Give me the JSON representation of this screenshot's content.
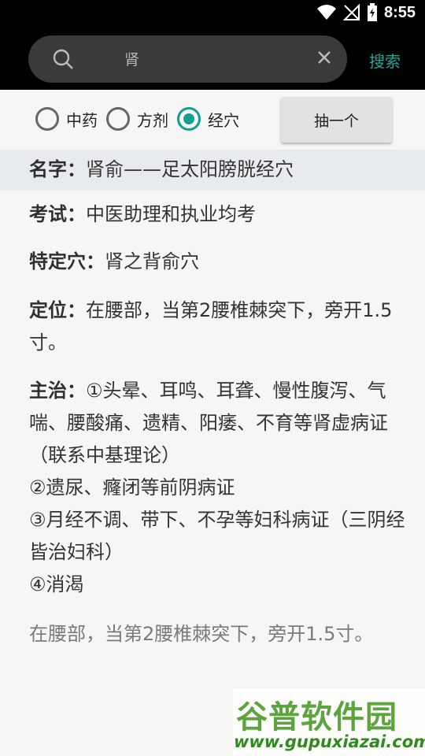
{
  "status_bar": {
    "time": "8:55"
  },
  "search": {
    "query": "肾",
    "button_label": "搜索"
  },
  "types": [
    {
      "label": "中药",
      "checked": false
    },
    {
      "label": "方剂",
      "checked": false
    },
    {
      "label": "经穴",
      "checked": true
    }
  ],
  "draw_button": "抽一个",
  "detail": {
    "name_label": "名字：",
    "name_value": "肾俞——足太阳膀胱经穴",
    "exam_label": "考试：",
    "exam_value": "中医助理和执业均考",
    "special_label": "特定穴：",
    "special_value": "肾之背俞穴",
    "location_label": "定位：",
    "location_value": "在腰部，当第2腰椎棘突下，旁开1.5寸。",
    "indication_label": "主治：",
    "indication_lines": [
      "①头晕、耳鸣、耳聋、慢性腹泻、气喘、腰酸痛、遗精、阳痿、不育等肾虚病证（联系中基理论）",
      "②遗尿、癃闭等前阴病证",
      "③月经不调、带下、不孕等妇科病证（三阴经皆治妇科）",
      "④消渴"
    ],
    "footnote": "在腰部，当第2腰椎棘突下，旁开1.5寸。"
  },
  "watermark": {
    "title": "谷普软件园",
    "url": "www.gupuxiazai.com"
  }
}
